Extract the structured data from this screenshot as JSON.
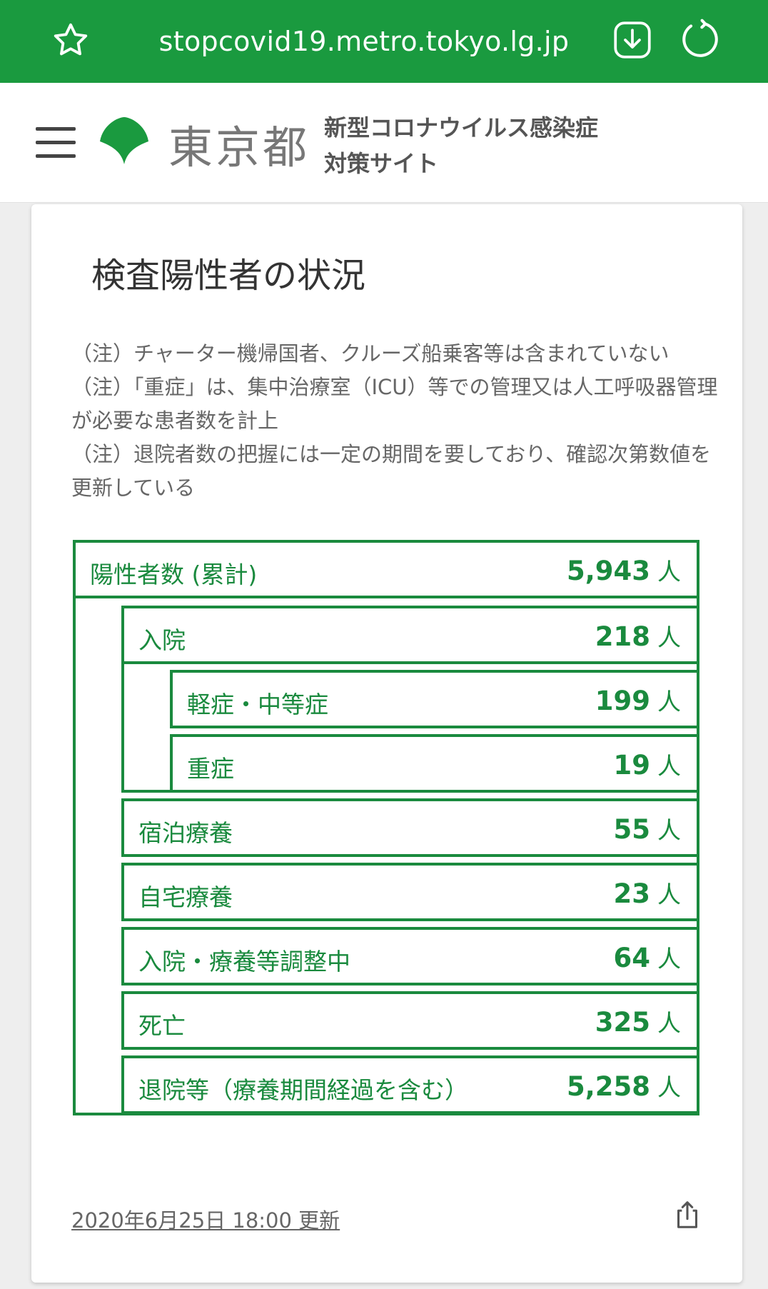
{
  "browser": {
    "url": "stopcovid19.metro.tokyo.lg.jp"
  },
  "header": {
    "logo_text": "東京都",
    "site_title_line1": "新型コロナウイルス感染症",
    "site_title_line2": "対策サイト"
  },
  "card": {
    "title": "検査陽性者の状況",
    "notes": [
      "（注）チャーター機帰国者、クルーズ船乗客等は含まれていない",
      "（注）「重症」は、集中治療室（ICU）等での管理又は人工呼吸器管理が必要な患者数を計上",
      "（注）退院者数の把握には一定の期間を要しており、確認次第数値を更新している"
    ],
    "unit": "人",
    "rows": [
      {
        "label": "陽性者数 (累計)",
        "value": "5,943"
      },
      {
        "label": "入院",
        "value": "218"
      },
      {
        "label": "軽症・中等症",
        "value": "199"
      },
      {
        "label": "重症",
        "value": "19"
      },
      {
        "label": "宿泊療養",
        "value": "55"
      },
      {
        "label": "自宅療養",
        "value": "23"
      },
      {
        "label": "入院・療養等調整中",
        "value": "64"
      },
      {
        "label": "死亡",
        "value": "325"
      },
      {
        "label": "退院等（療養期間経過を含む）",
        "value": "5,258"
      }
    ],
    "updated": "2020年6月25日 18:00 更新"
  },
  "colors": {
    "brand_green": "#1a9a3f",
    "box_green": "#1a8a3e"
  }
}
